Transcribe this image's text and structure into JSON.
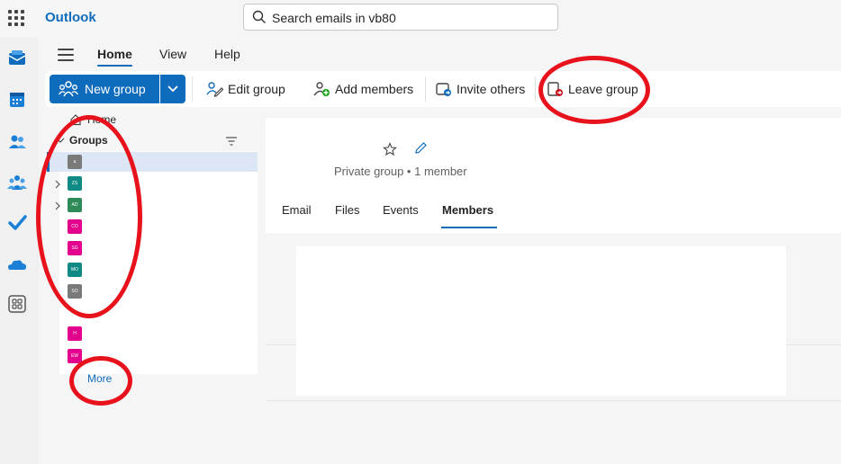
{
  "app": {
    "name": "Outlook"
  },
  "search": {
    "placeholder": "Search emails in vb80"
  },
  "tabs": [
    {
      "label": "Home",
      "active": true
    },
    {
      "label": "View"
    },
    {
      "label": "Help"
    }
  ],
  "ribbon": {
    "new_group": "New group",
    "edit_group": "Edit group",
    "add_members": "Add members",
    "invite_others": "Invite others",
    "leave_group": "Leave group"
  },
  "nav": {
    "home": "Home",
    "groups": "Groups",
    "more": "More",
    "group_avatars": [
      {
        "initials": "a",
        "color": "#7a7a7a"
      },
      {
        "initials": "ZS",
        "color": "#0f8a85"
      },
      {
        "initials": "AD",
        "color": "#2e8b57"
      },
      {
        "initials": "CO",
        "color": "#e3008c"
      },
      {
        "initials": "SG",
        "color": "#e3008c"
      },
      {
        "initials": "MO",
        "color": "#0f8a85"
      },
      {
        "initials": "SO",
        "color": "#7a7a7a"
      },
      {
        "initials": "H",
        "color": "#e3008c"
      },
      {
        "initials": "EW",
        "color": "#e3008c"
      }
    ]
  },
  "group": {
    "privacy": "Private group • 1 member",
    "tabs": [
      "Email",
      "Files",
      "Events",
      "Members"
    ],
    "active_tab": "Members"
  },
  "colors": {
    "accent": "#0f6cbd",
    "annotation": "#e8121c"
  }
}
